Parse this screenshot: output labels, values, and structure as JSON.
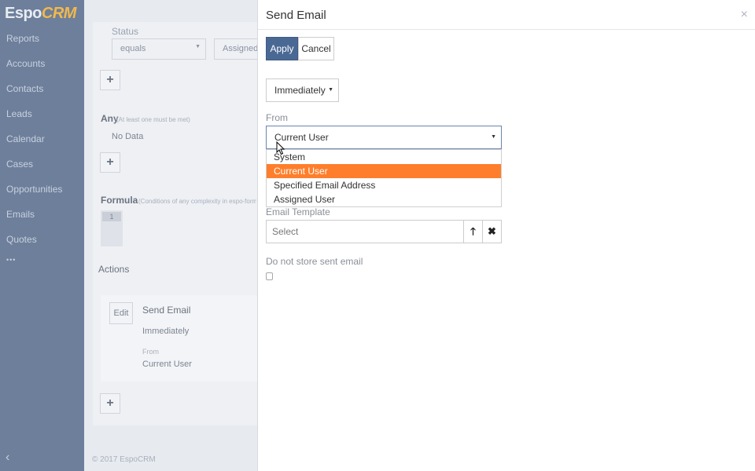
{
  "logo": {
    "espo": "Espo",
    "crm": "CRM"
  },
  "sidebar": {
    "items": [
      {
        "label": "Reports"
      },
      {
        "label": "Accounts"
      },
      {
        "label": "Contacts"
      },
      {
        "label": "Leads"
      },
      {
        "label": "Calendar"
      },
      {
        "label": "Cases"
      },
      {
        "label": "Opportunities"
      },
      {
        "label": "Emails"
      },
      {
        "label": "Quotes"
      }
    ],
    "more": "•••",
    "collapse": "‹"
  },
  "background": {
    "status_label": "Status",
    "status_operator": "equals",
    "status_value": "Assigned",
    "any_label": "Any",
    "any_hint": "(At least one must be met)",
    "no_data": "No Data",
    "formula_label": "Formula",
    "formula_hint": "(Conditions of any complexity in espo-formula",
    "formula_line": "1",
    "actions_label": "Actions",
    "edit_label": "Edit",
    "action_name": "Send Email",
    "action_exec": "Immediately",
    "action_from_label": "From",
    "action_from_value": "Current User",
    "footer": "© 2017 EspoCRM",
    "plus": "+"
  },
  "modal": {
    "title": "Send Email",
    "close": "×",
    "apply_label": "Apply",
    "cancel_label": "Cancel",
    "execution_time": "Immediately",
    "from_label": "From",
    "from_value": "Current User",
    "from_options": [
      "System",
      "Current User",
      "Specified Email Address",
      "Assigned User"
    ],
    "email_template_label": "Email Template",
    "email_template_placeholder": "Select",
    "do_not_store_label": "Do not store sent email"
  },
  "colors": {
    "sidebar_bg": "#6d7f9b",
    "apply_bg": "#4a6894",
    "dropdown_highlight": "#ff7e2b",
    "logo_accent": "#f2b84b"
  }
}
